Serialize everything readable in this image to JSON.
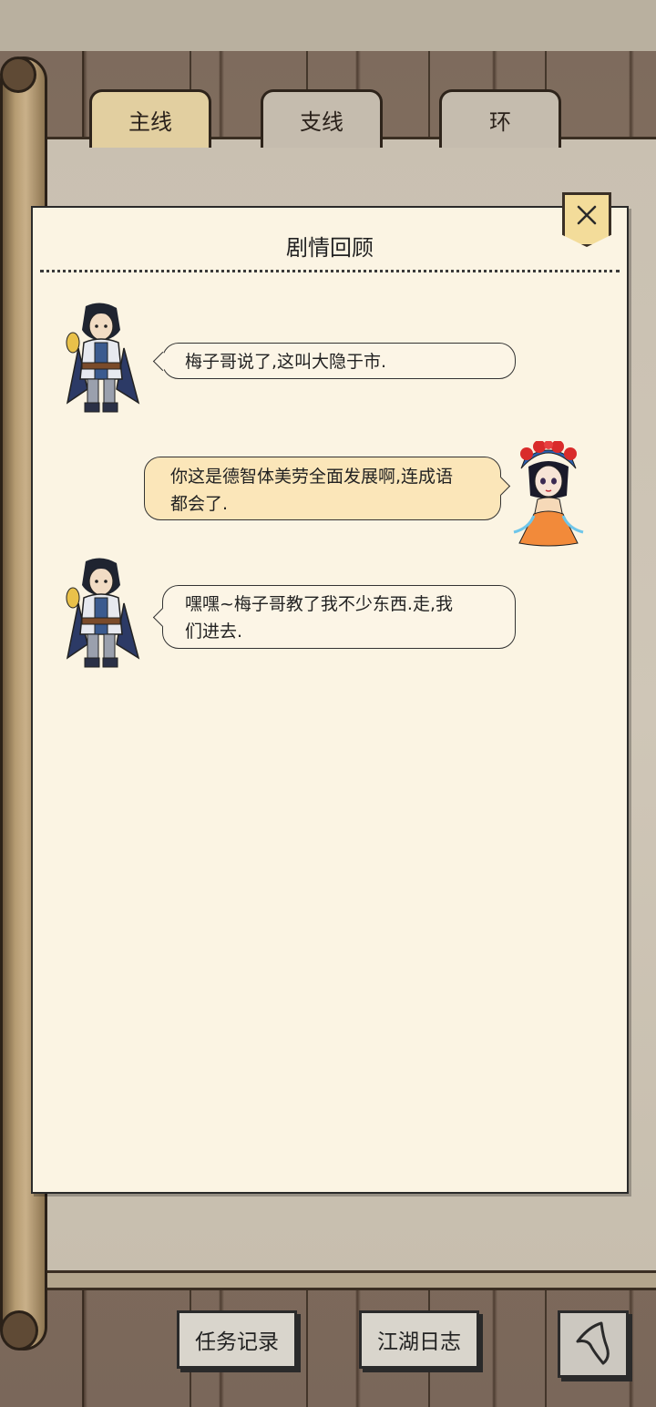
{
  "tabs": [
    {
      "label": "主线",
      "active": true
    },
    {
      "label": "支线",
      "active": false
    },
    {
      "label": "环",
      "active": false
    }
  ],
  "dialog": {
    "title": "剧情回顾",
    "close_icon": "close-icon"
  },
  "messages": [
    {
      "speaker": "male-swordsman",
      "side": "left",
      "text": "梅子哥说了,这叫大隐于市."
    },
    {
      "speaker": "opera-girl",
      "side": "right",
      "text_line1": "你这是德智体美劳全面发展啊,连成语",
      "text_line2": "都会了."
    },
    {
      "speaker": "male-swordsman",
      "side": "left",
      "text_line1": "嘿嘿~梅子哥教了我不少东西.走,我",
      "text_line2": "们进去."
    }
  ],
  "bottom": {
    "task_records": "任务记录",
    "jianghu_journal": "江湖日志",
    "back_icon": "back-arrow-icon"
  },
  "colors": {
    "paper": "#fbf4e3",
    "active_tab": "#e2cfa0",
    "right_bubble": "#fbe6b9",
    "close_button": "#f3dc9a"
  }
}
